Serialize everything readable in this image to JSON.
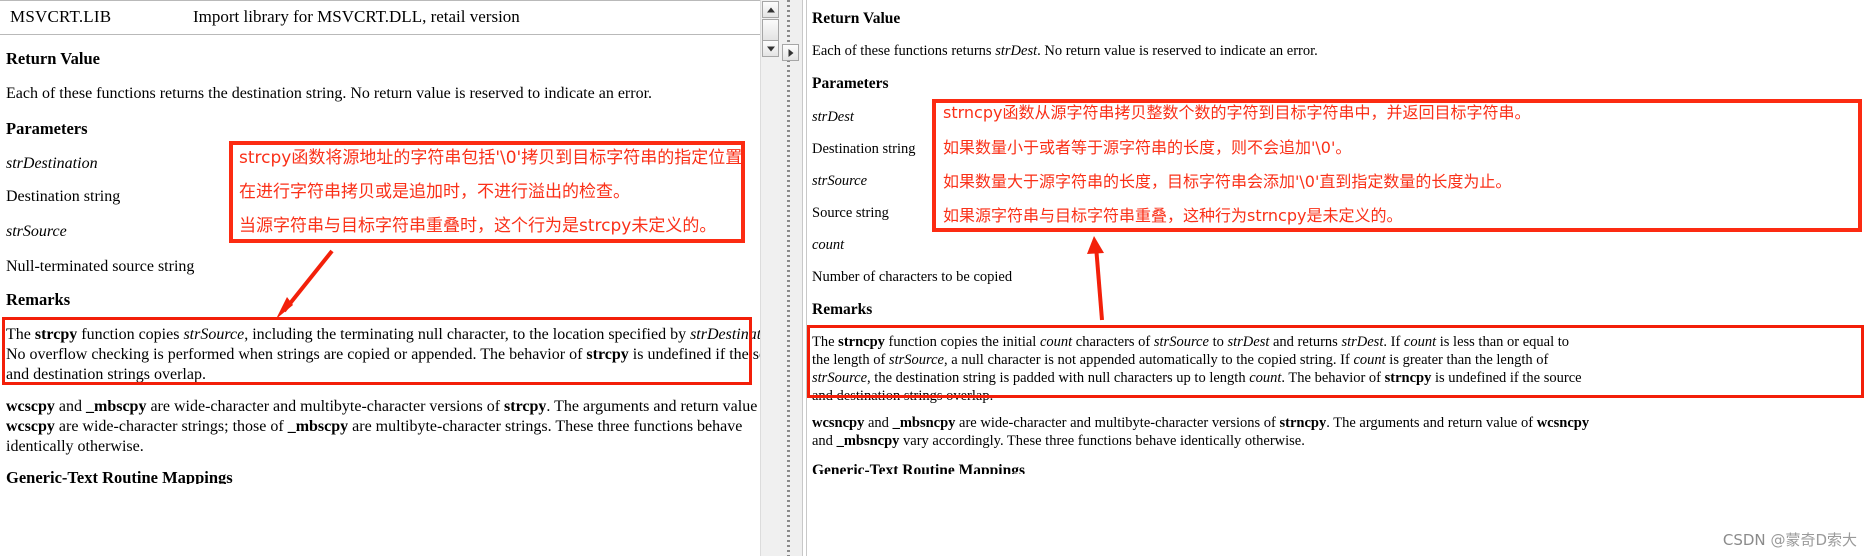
{
  "left_pane": {
    "table_row": {
      "lib_name": "MSVCRT.LIB",
      "description": "Import library for MSVCRT.DLL, retail version"
    },
    "sections": {
      "return_value_heading": "Return Value",
      "return_value_text": "Each of these functions returns the destination string. No return value is reserved to indicate an error.",
      "parameters_heading": "Parameters",
      "param_1_name": "strDestination",
      "param_1_desc": "Destination string",
      "param_2_name": "strSource",
      "param_2_desc": "Null-terminated source string",
      "remarks_heading": "Remarks",
      "remarks_line_1_a": "The ",
      "remarks_line_1_b": "strcpy",
      "remarks_line_1_c": " function copies ",
      "remarks_line_1_d": "strSource",
      "remarks_line_1_e": ", including the terminating null character, to the location specified by ",
      "remarks_line_1_f": "strDestination",
      "remarks_line_1_g": ".",
      "remarks_line_2_a": "No overflow checking is performed when strings are copied or appended. The behavior of ",
      "remarks_line_2_b": "strcpy",
      "remarks_line_2_c": " is undefined if the source",
      "remarks_line_3": "and destination strings overlap.",
      "wide_line_1_a": "wcscpy",
      "wide_line_1_b": " and ",
      "wide_line_1_c": "_mbscpy",
      "wide_line_1_d": " are wide-character and multibyte-character versions of ",
      "wide_line_1_e": "strcpy",
      "wide_line_1_f": ". The arguments and return value of",
      "wide_line_2_a": "wcscpy",
      "wide_line_2_b": " are wide-character strings; those of ",
      "wide_line_2_c": "_mbscpy",
      "wide_line_2_d": " are multibyte-character strings. These three functions behave",
      "wide_line_3": "identically otherwise.",
      "cutoff_line": "Generic-Text Routine Mappings"
    },
    "annotation": {
      "line_1": "strcpy函数将源地址的字符串包括'\\0'拷贝到目标字符串的指定位置",
      "line_2": "在进行字符串拷贝或是追加时，不进行溢出的检查。",
      "line_3": "当源字符串与目标字符串重叠时，这个行为是strcpy未定义的。"
    }
  },
  "right_pane": {
    "sections": {
      "return_value_heading": "Return Value",
      "return_value_line_a": "Each of these functions returns ",
      "return_value_line_b": "strDest",
      "return_value_line_c": ". No return value is reserved to indicate an error.",
      "parameters_heading": "Parameters",
      "param_1_name": "strDest",
      "param_1_desc": "Destination string",
      "param_2_name": "strSource",
      "param_2_desc": "Source string",
      "param_3_name": "count",
      "param_3_desc": "Number of characters to be copied",
      "remarks_heading": "Remarks",
      "remarks_l1": [
        {
          "t": "The ",
          "s": "n"
        },
        {
          "t": "strncpy",
          "s": "b"
        },
        {
          "t": " function copies the initial ",
          "s": "n"
        },
        {
          "t": "count",
          "s": "i"
        },
        {
          "t": " characters of ",
          "s": "n"
        },
        {
          "t": "strSource",
          "s": "i"
        },
        {
          "t": " to ",
          "s": "n"
        },
        {
          "t": "strDest",
          "s": "i"
        },
        {
          "t": " and returns ",
          "s": "n"
        },
        {
          "t": "strDest",
          "s": "i"
        },
        {
          "t": ". If ",
          "s": "n"
        },
        {
          "t": "count",
          "s": "i"
        },
        {
          "t": " is less than or equal to",
          "s": "n"
        }
      ],
      "remarks_l2": [
        {
          "t": "the length of ",
          "s": "n"
        },
        {
          "t": "strSource",
          "s": "i"
        },
        {
          "t": ", a null character is not appended automatically to the copied string. If ",
          "s": "n"
        },
        {
          "t": "count",
          "s": "i"
        },
        {
          "t": " is greater than the length of",
          "s": "n"
        }
      ],
      "remarks_l3": [
        {
          "t": "strSource",
          "s": "i"
        },
        {
          "t": ", the destination string is padded with null characters up to length ",
          "s": "n"
        },
        {
          "t": "count",
          "s": "i"
        },
        {
          "t": ". The behavior of ",
          "s": "n"
        },
        {
          "t": "strncpy",
          "s": "b"
        },
        {
          "t": " is undefined if the source",
          "s": "n"
        }
      ],
      "remarks_l4": [
        {
          "t": "and destination strings overlap.",
          "s": "n"
        }
      ],
      "wide_l1": [
        {
          "t": "wcsncpy",
          "s": "b"
        },
        {
          "t": " and ",
          "s": "n"
        },
        {
          "t": "_mbsncpy",
          "s": "b"
        },
        {
          "t": " are wide-character and multibyte-character versions of ",
          "s": "n"
        },
        {
          "t": "strncpy",
          "s": "b"
        },
        {
          "t": ". The arguments and return value of ",
          "s": "n"
        },
        {
          "t": "wcsncpy",
          "s": "b"
        }
      ],
      "wide_l2": [
        {
          "t": "and ",
          "s": "n"
        },
        {
          "t": "_mbsncpy",
          "s": "b"
        },
        {
          "t": " vary accordingly. These three functions behave identically otherwise.",
          "s": "n"
        }
      ],
      "cutoff_line": "Generic-Text Routine Mappings"
    },
    "annotation": {
      "line_1": "strncpy函数从源字符串拷贝整数个数的字符到目标字符串中，并返回目标字符串。",
      "line_2": "如果数量小于或者等于源字符串的长度，则不会追加'\\0'。",
      "line_3": "如果数量大于源字符串的长度，目标字符串会添加'\\0'直到指定数量的长度为止。",
      "line_4": "如果源字符串与目标字符串重叠，这种行为strncpy是未定义的。"
    }
  },
  "watermark": {
    "brand": "CSDN",
    "author": "@蒙奇D索大"
  },
  "colors": {
    "annotation_red": "#fa3018",
    "box_red": "#fc2b12",
    "text_black": "#000000",
    "scrollbar_bg": "#f0f0f0",
    "watermark_gray": "#8b8b8b"
  },
  "scrollbars": {
    "up_arrow": "triangle-up-icon",
    "down_arrow": "triangle-down-icon",
    "right_arrow": "triangle-right-icon"
  }
}
